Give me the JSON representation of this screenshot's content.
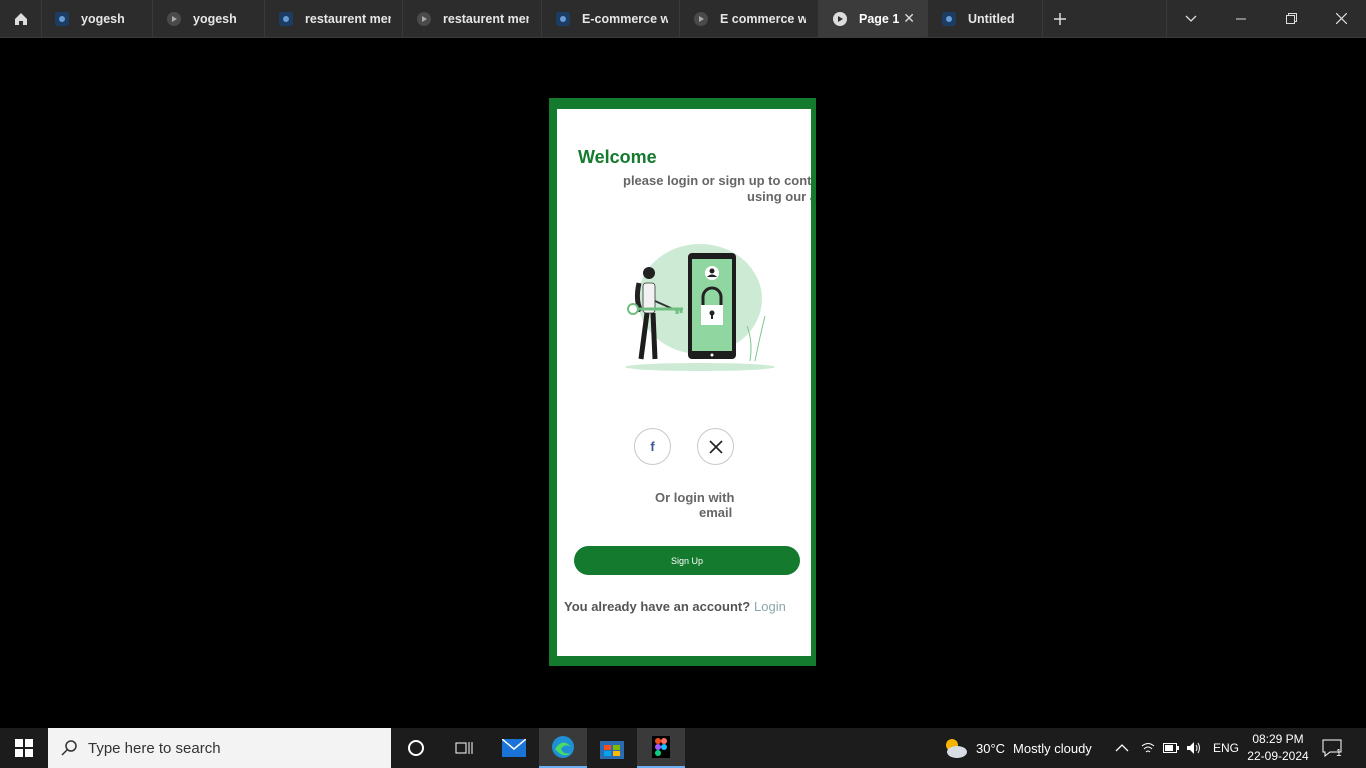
{
  "tabs": [
    {
      "label": "yogesh",
      "kind": "figma"
    },
    {
      "label": "yogesh",
      "kind": "prototype"
    },
    {
      "label": "restaurent menu",
      "kind": "figma"
    },
    {
      "label": "restaurent menu",
      "kind": "prototype"
    },
    {
      "label": "E-commerce website",
      "kind": "figma"
    },
    {
      "label": "E commerce website",
      "kind": "prototype"
    },
    {
      "label": "Page 1",
      "kind": "prototype",
      "active": true
    },
    {
      "label": "Untitled",
      "kind": "figma"
    }
  ],
  "app": {
    "welcome": "Welcome",
    "subtitle_line1": "please login or sign up to continue",
    "subtitle_line2": "using our app",
    "social_facebook": "f",
    "or_line1": "Or login with",
    "or_line2": "email",
    "signup_label": "Sign Up",
    "already_text": "You already have an account?",
    "login_link": "Login"
  },
  "taskbar": {
    "search_placeholder": "Type here to search",
    "weather_temp": "30°C",
    "weather_desc": "Mostly cloudy",
    "language": "ENG",
    "time": "08:29 PM",
    "date": "22-09-2024",
    "notifications": "1"
  },
  "colors": {
    "brand_green": "#137a2e"
  }
}
